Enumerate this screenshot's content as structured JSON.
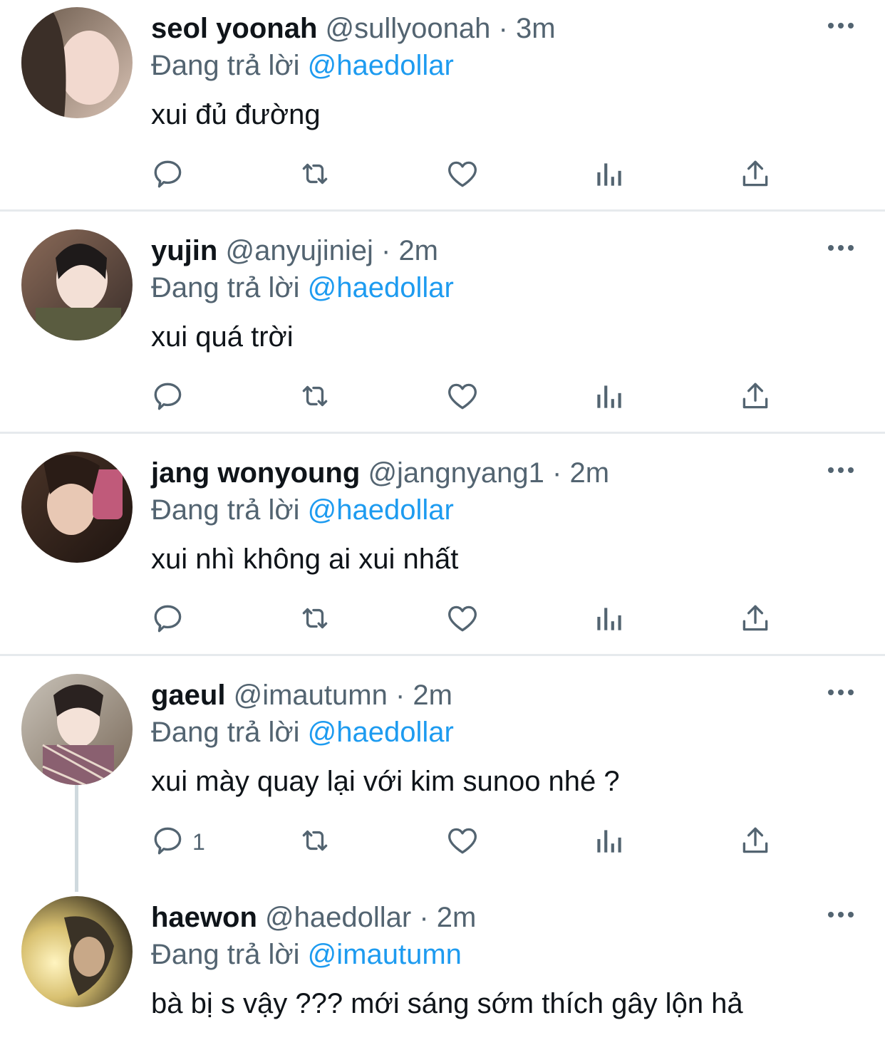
{
  "colors": {
    "text": "#0f1419",
    "secondary": "#536471",
    "link": "#1d9bf0",
    "divider": "#e6eaed"
  },
  "replying_prefix": "Đang trả lời",
  "tweets": [
    {
      "name": "seol yoonah",
      "handle": "@sullyoonah",
      "sep": "·",
      "time": "3m",
      "reply_to": "@haedollar",
      "text": "xui đủ đường",
      "reply_count": ""
    },
    {
      "name": "yujin",
      "handle": "@anyujiniej",
      "sep": "·",
      "time": "2m",
      "reply_to": "@haedollar",
      "text": "xui quá trời",
      "reply_count": ""
    },
    {
      "name": "jang wonyoung",
      "handle": "@jangnyang1",
      "sep": "·",
      "time": "2m",
      "reply_to": "@haedollar",
      "text": "xui nhì không ai xui nhất",
      "reply_count": ""
    },
    {
      "name": "gaeul",
      "handle": "@imautumn",
      "sep": "·",
      "time": "2m",
      "reply_to": "@haedollar",
      "text": "xui mày quay lại với kim sunoo nhé ?",
      "reply_count": "1"
    },
    {
      "name": "haewon",
      "handle": "@haedollar",
      "sep": "·",
      "time": "2m",
      "reply_to": "@imautumn",
      "text": "bà bị s vậy ??? mới sáng sớm thích gây lộn hả",
      "reply_count": ""
    }
  ],
  "icons": {
    "reply": "reply-icon",
    "retweet": "retweet-icon",
    "like": "like-icon",
    "views": "views-icon",
    "share": "share-icon",
    "more": "more-icon"
  }
}
